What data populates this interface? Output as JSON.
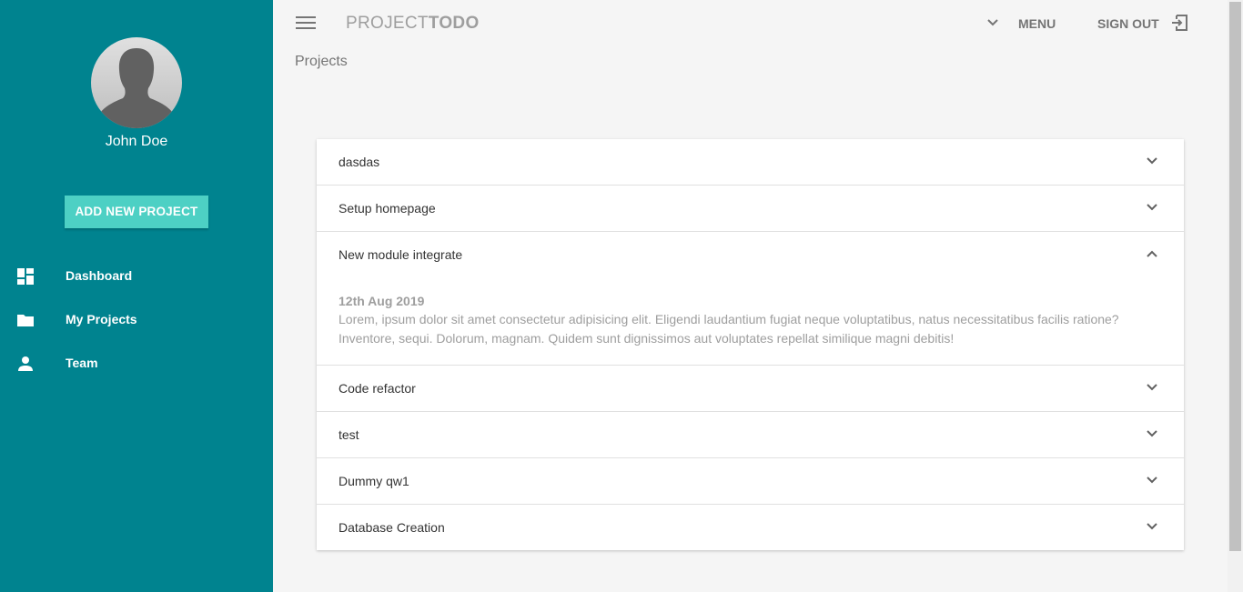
{
  "sidebar": {
    "user_name": "John Doe",
    "add_button_label": "ADD NEW PROJECT",
    "nav": [
      {
        "label": "Dashboard",
        "icon": "dashboard-icon"
      },
      {
        "label": "My Projects",
        "icon": "folder-icon"
      },
      {
        "label": "Team",
        "icon": "person-icon"
      }
    ]
  },
  "header": {
    "brand_light": "PROJECT",
    "brand_bold": "TODO",
    "menu_label": "MENU",
    "signout_label": "SIGN OUT"
  },
  "page": {
    "title": "Projects"
  },
  "projects": [
    {
      "title": "dasdas",
      "expanded": false
    },
    {
      "title": "Setup homepage",
      "expanded": false
    },
    {
      "title": "New module integrate",
      "expanded": true,
      "date": "12th Aug 2019",
      "description": "Lorem, ipsum dolor sit amet consectetur adipisicing elit. Eligendi laudantium fugiat neque voluptatibus, natus necessitatibus facilis ratione? Inventore, sequi. Dolorum, magnam. Quidem sunt dignissimos aut voluptates repellat similique magni debitis!"
    },
    {
      "title": "Code refactor",
      "expanded": false
    },
    {
      "title": "test",
      "expanded": false
    },
    {
      "title": "Dummy qw1",
      "expanded": false
    },
    {
      "title": "Database Creation",
      "expanded": false
    }
  ],
  "colors": {
    "sidebar_bg": "#00838f",
    "accent_button": "#4dd0c4",
    "page_bg": "#f5f5f5"
  }
}
